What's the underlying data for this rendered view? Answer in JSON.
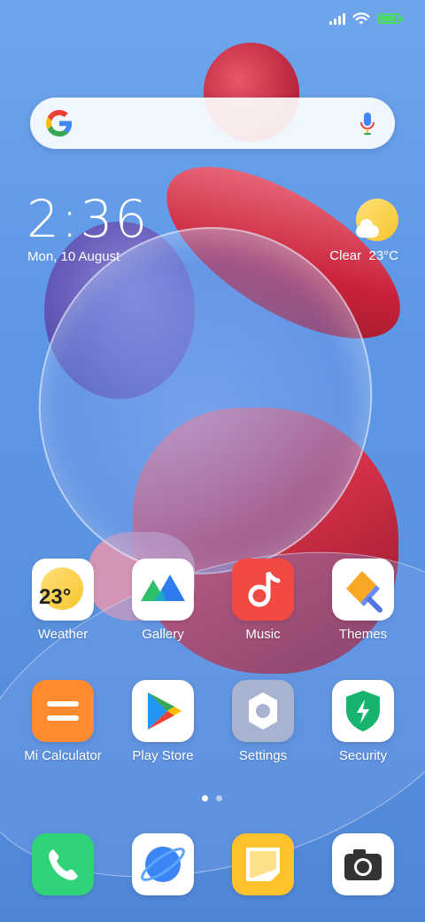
{
  "status_bar": {
    "battery_charging": true,
    "battery_level": 0.8
  },
  "search": {
    "provider_icon": "google-g-icon",
    "mic_icon": "microphone-icon"
  },
  "clock": {
    "time": "2:36",
    "date": "Mon, 10 August"
  },
  "weather": {
    "condition": "Clear",
    "temperature": "23°C",
    "icon": "partly-sunny-icon"
  },
  "apps_row1": [
    {
      "label": "Weather",
      "icon": "weather-icon",
      "badge_text": "23°"
    },
    {
      "label": "Gallery",
      "icon": "gallery-icon"
    },
    {
      "label": "Music",
      "icon": "music-icon"
    },
    {
      "label": "Themes",
      "icon": "themes-icon"
    }
  ],
  "apps_row2": [
    {
      "label": "Mi Calculator",
      "icon": "calculator-icon"
    },
    {
      "label": "Play Store",
      "icon": "play-store-icon"
    },
    {
      "label": "Settings",
      "icon": "settings-icon"
    },
    {
      "label": "Security",
      "icon": "security-icon"
    }
  ],
  "page_indicator": {
    "pages": 2,
    "current": 1
  },
  "dock": [
    {
      "name": "phone",
      "icon": "phone-icon"
    },
    {
      "name": "browser",
      "icon": "browser-icon"
    },
    {
      "name": "messages",
      "icon": "messages-icon"
    },
    {
      "name": "camera",
      "icon": "camera-icon"
    }
  ],
  "colors": {
    "weather_bg": "#ffffff",
    "gallery_bg": "#ffffff",
    "music_bg": "#f04a42",
    "themes_bg": "#ffffff",
    "calculator_bg": "#ff8a30",
    "playstore_bg": "#ffffff",
    "settings_bg": "#a8b4cf",
    "security_bg": "#ffffff",
    "phone_bg": "#2fd47a",
    "browser_bg": "#ffffff",
    "messages_bg": "#ffc12e",
    "camera_bg": "#ffffff"
  }
}
